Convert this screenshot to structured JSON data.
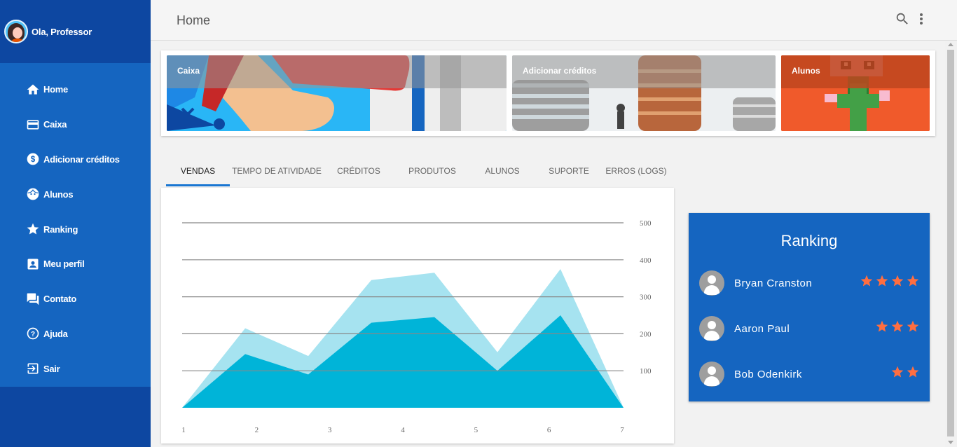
{
  "user": {
    "greeting": "Ola, Professor"
  },
  "sidebar": {
    "items": [
      {
        "label": "Home",
        "icon": "home-icon"
      },
      {
        "label": "Caixa",
        "icon": "credit-card-icon"
      },
      {
        "label": "Adicionar créditos",
        "icon": "dollar-icon"
      },
      {
        "label": "Alunos",
        "icon": "face-icon"
      },
      {
        "label": "Ranking",
        "icon": "star-icon"
      },
      {
        "label": "Meu perfil",
        "icon": "account-box-icon"
      },
      {
        "label": "Contato",
        "icon": "forum-icon"
      },
      {
        "label": "Ajuda",
        "icon": "help-icon"
      },
      {
        "label": "Sair",
        "icon": "exit-icon"
      }
    ]
  },
  "topbar": {
    "title": "Home"
  },
  "banners": [
    {
      "label": "Caixa"
    },
    {
      "label": "Adicionar créditos"
    },
    {
      "label": "Alunos"
    }
  ],
  "tabs": [
    "VENDAS",
    "TEMPO DE ATIVIDADE",
    "CRÉDITOS",
    "PRODUTOS",
    "ALUNOS",
    "SUPORTE",
    "ERROS (LOGS)"
  ],
  "active_tab": "VENDAS",
  "chart_data": {
    "type": "area",
    "x": [
      1,
      2,
      3,
      4,
      5,
      6,
      7
    ],
    "series": [
      {
        "values": [
          0,
          215,
          140,
          345,
          365,
          150,
          375,
          0
        ]
      },
      {
        "values": [
          0,
          145,
          90,
          230,
          245,
          100,
          250,
          0
        ]
      }
    ],
    "ylim": [
      0,
      500
    ],
    "yticks": [
      100,
      200,
      300,
      400,
      500
    ],
    "grid": true,
    "colors": [
      "#a6e3f0",
      "#00b4d8"
    ]
  },
  "ranking": {
    "title": "Ranking",
    "entries": [
      {
        "name": "Bryan Cranston",
        "stars": 4
      },
      {
        "name": "Aaron Paul",
        "stars": 3
      },
      {
        "name": "Bob Odenkirk",
        "stars": 2
      }
    ],
    "star_color": "#ff6e40"
  }
}
